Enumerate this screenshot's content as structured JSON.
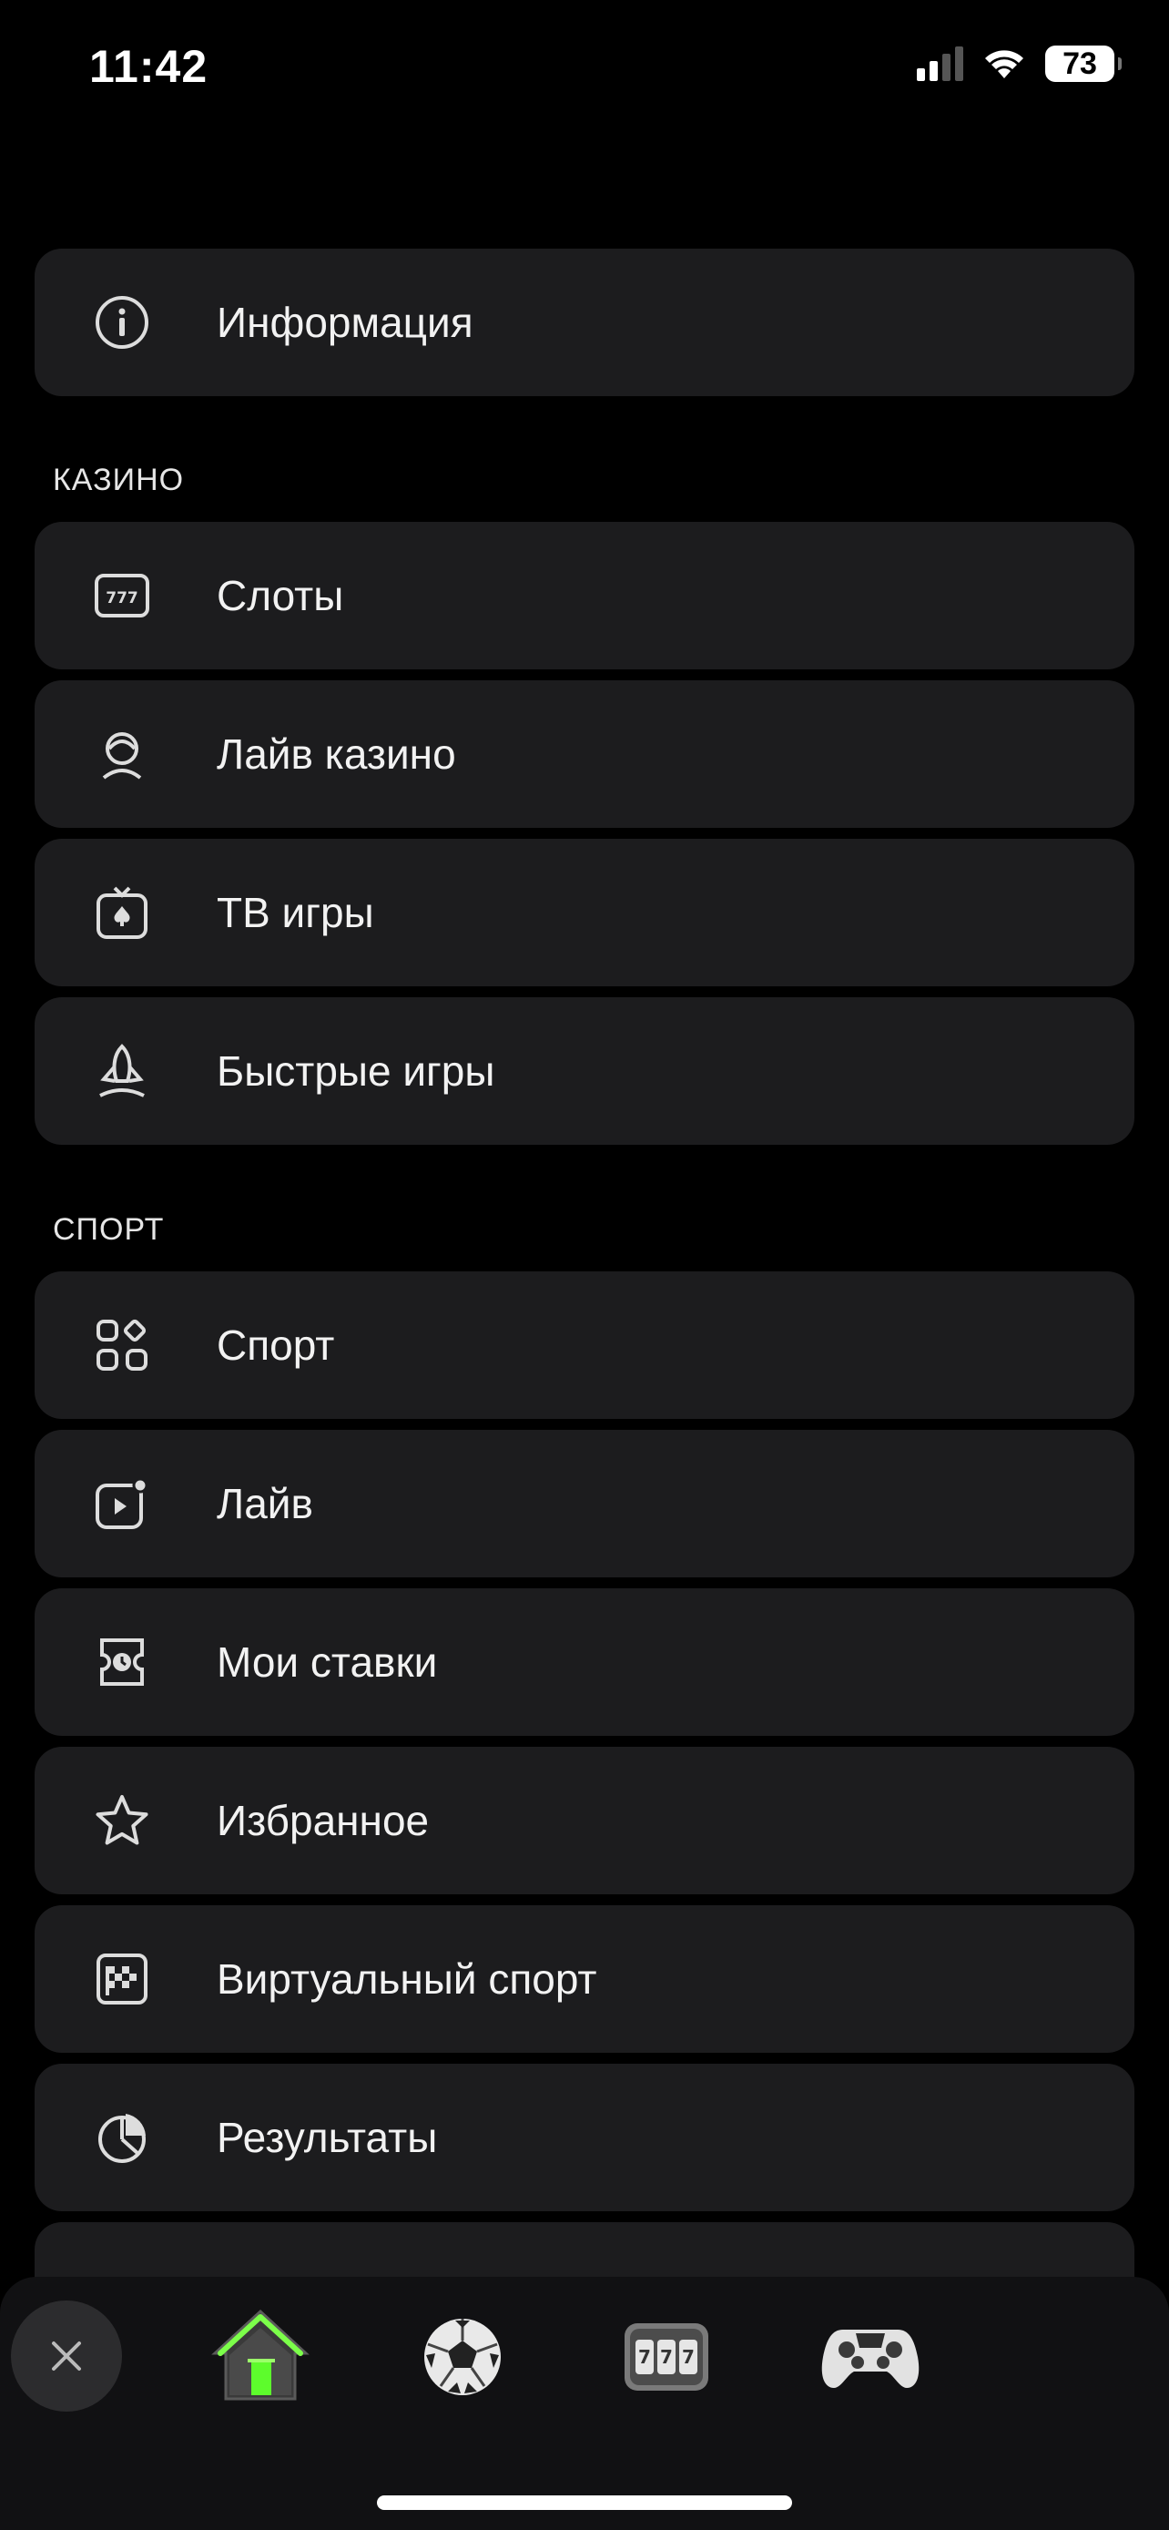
{
  "status_bar": {
    "time": "11:42",
    "battery": "73"
  },
  "info_item": {
    "label": "Информация",
    "icon": "info-icon"
  },
  "casino": {
    "header": "КАЗИНО",
    "items": [
      {
        "label": "Слоты",
        "icon": "slots-777-icon"
      },
      {
        "label": "Лайв казино",
        "icon": "live-dealer-icon"
      },
      {
        "label": "ТВ игры",
        "icon": "tv-games-icon"
      },
      {
        "label": "Быстрые игры",
        "icon": "rocket-icon"
      }
    ]
  },
  "sport": {
    "header": "СПОРТ",
    "items": [
      {
        "label": "Спорт",
        "icon": "sport-grid-icon"
      },
      {
        "label": "Лайв",
        "icon": "live-play-icon"
      },
      {
        "label": "Мои ставки",
        "icon": "bet-ticket-icon"
      },
      {
        "label": "Избранное",
        "icon": "star-icon"
      },
      {
        "label": "Виртуальный спорт",
        "icon": "checkered-flag-icon"
      },
      {
        "label": "Результаты",
        "icon": "results-pie-icon"
      }
    ]
  },
  "tabbar": {
    "items": [
      {
        "name": "close",
        "icon": "close-icon"
      },
      {
        "name": "home",
        "icon": "home-icon"
      },
      {
        "name": "sport",
        "icon": "soccer-ball-icon"
      },
      {
        "name": "casino",
        "icon": "slot-machine-icon"
      },
      {
        "name": "games",
        "icon": "gamepad-icon"
      }
    ]
  }
}
